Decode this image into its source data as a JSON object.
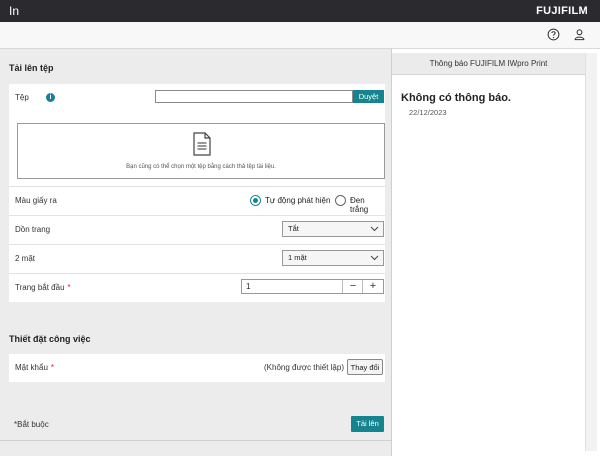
{
  "header": {
    "app_title": "In",
    "brand": "FUJIFILM"
  },
  "toolbar": {
    "help_icon": "question-circle-icon",
    "user_icon": "user-icon"
  },
  "upload": {
    "section_title": "Tải lên tệp",
    "file_label": "Tệp",
    "file_value": "",
    "browse_label": "Duyệt",
    "drop_text": "Bạn cũng có thể chọn một tệp bằng cách thả tệp tài liệu."
  },
  "options": {
    "color": {
      "label": "Màu giấy ra",
      "options": [
        "Tự động phát hiện",
        "Đen trắng"
      ],
      "selected": "Tự động phát hiện"
    },
    "collate": {
      "label": "Dồn trang",
      "value": "Tắt"
    },
    "duplex": {
      "label": "2 mặt",
      "value": "1 mặt"
    },
    "start_page": {
      "label": "Trang bắt đầu",
      "required_mark": "*",
      "value": "1",
      "minus": "−",
      "plus": "+"
    }
  },
  "job": {
    "section_title": "Thiết đặt công việc",
    "password_label": "Mật khẩu",
    "required_mark": "*",
    "password_status": "(Không được thiết lập)",
    "change_label": "Thay đổi"
  },
  "footer": {
    "required_note": "*Bắt buộc",
    "upload_label": "Tải lên"
  },
  "notices": {
    "header": "Thông báo FUJIFILM IWpro Print",
    "title": "Không có thông báo.",
    "date": "22/12/2023"
  },
  "colors": {
    "accent": "#14848f",
    "topbar": "#2b2b2f",
    "required": "#dd2222"
  }
}
